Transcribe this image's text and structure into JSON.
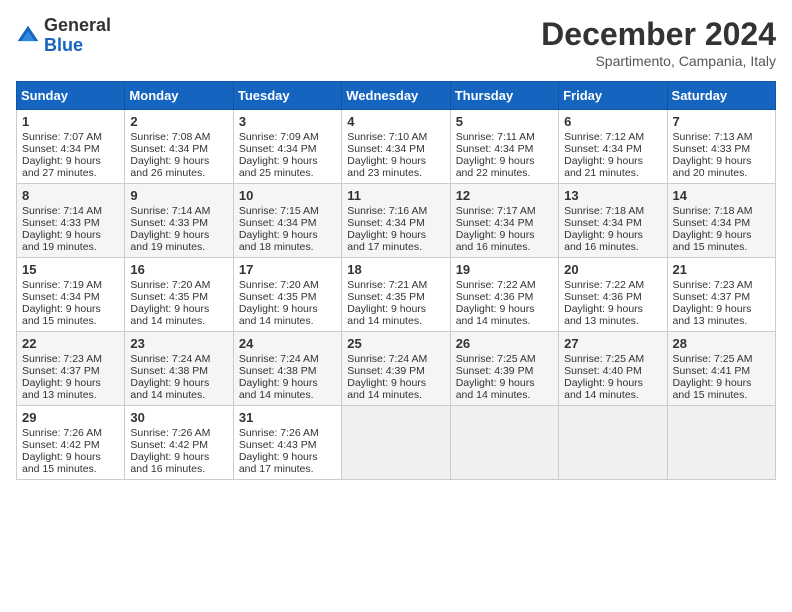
{
  "header": {
    "logo_line1": "General",
    "logo_line2": "Blue",
    "month": "December 2024",
    "location": "Spartimento, Campania, Italy"
  },
  "weekdays": [
    "Sunday",
    "Monday",
    "Tuesday",
    "Wednesday",
    "Thursday",
    "Friday",
    "Saturday"
  ],
  "weeks": [
    [
      {
        "day": "1",
        "lines": [
          "Sunrise: 7:07 AM",
          "Sunset: 4:34 PM",
          "Daylight: 9 hours",
          "and 27 minutes."
        ]
      },
      {
        "day": "2",
        "lines": [
          "Sunrise: 7:08 AM",
          "Sunset: 4:34 PM",
          "Daylight: 9 hours",
          "and 26 minutes."
        ]
      },
      {
        "day": "3",
        "lines": [
          "Sunrise: 7:09 AM",
          "Sunset: 4:34 PM",
          "Daylight: 9 hours",
          "and 25 minutes."
        ]
      },
      {
        "day": "4",
        "lines": [
          "Sunrise: 7:10 AM",
          "Sunset: 4:34 PM",
          "Daylight: 9 hours",
          "and 23 minutes."
        ]
      },
      {
        "day": "5",
        "lines": [
          "Sunrise: 7:11 AM",
          "Sunset: 4:34 PM",
          "Daylight: 9 hours",
          "and 22 minutes."
        ]
      },
      {
        "day": "6",
        "lines": [
          "Sunrise: 7:12 AM",
          "Sunset: 4:34 PM",
          "Daylight: 9 hours",
          "and 21 minutes."
        ]
      },
      {
        "day": "7",
        "lines": [
          "Sunrise: 7:13 AM",
          "Sunset: 4:33 PM",
          "Daylight: 9 hours",
          "and 20 minutes."
        ]
      }
    ],
    [
      {
        "day": "8",
        "lines": [
          "Sunrise: 7:14 AM",
          "Sunset: 4:33 PM",
          "Daylight: 9 hours",
          "and 19 minutes."
        ]
      },
      {
        "day": "9",
        "lines": [
          "Sunrise: 7:14 AM",
          "Sunset: 4:33 PM",
          "Daylight: 9 hours",
          "and 19 minutes."
        ]
      },
      {
        "day": "10",
        "lines": [
          "Sunrise: 7:15 AM",
          "Sunset: 4:34 PM",
          "Daylight: 9 hours",
          "and 18 minutes."
        ]
      },
      {
        "day": "11",
        "lines": [
          "Sunrise: 7:16 AM",
          "Sunset: 4:34 PM",
          "Daylight: 9 hours",
          "and 17 minutes."
        ]
      },
      {
        "day": "12",
        "lines": [
          "Sunrise: 7:17 AM",
          "Sunset: 4:34 PM",
          "Daylight: 9 hours",
          "and 16 minutes."
        ]
      },
      {
        "day": "13",
        "lines": [
          "Sunrise: 7:18 AM",
          "Sunset: 4:34 PM",
          "Daylight: 9 hours",
          "and 16 minutes."
        ]
      },
      {
        "day": "14",
        "lines": [
          "Sunrise: 7:18 AM",
          "Sunset: 4:34 PM",
          "Daylight: 9 hours",
          "and 15 minutes."
        ]
      }
    ],
    [
      {
        "day": "15",
        "lines": [
          "Sunrise: 7:19 AM",
          "Sunset: 4:34 PM",
          "Daylight: 9 hours",
          "and 15 minutes."
        ]
      },
      {
        "day": "16",
        "lines": [
          "Sunrise: 7:20 AM",
          "Sunset: 4:35 PM",
          "Daylight: 9 hours",
          "and 14 minutes."
        ]
      },
      {
        "day": "17",
        "lines": [
          "Sunrise: 7:20 AM",
          "Sunset: 4:35 PM",
          "Daylight: 9 hours",
          "and 14 minutes."
        ]
      },
      {
        "day": "18",
        "lines": [
          "Sunrise: 7:21 AM",
          "Sunset: 4:35 PM",
          "Daylight: 9 hours",
          "and 14 minutes."
        ]
      },
      {
        "day": "19",
        "lines": [
          "Sunrise: 7:22 AM",
          "Sunset: 4:36 PM",
          "Daylight: 9 hours",
          "and 14 minutes."
        ]
      },
      {
        "day": "20",
        "lines": [
          "Sunrise: 7:22 AM",
          "Sunset: 4:36 PM",
          "Daylight: 9 hours",
          "and 13 minutes."
        ]
      },
      {
        "day": "21",
        "lines": [
          "Sunrise: 7:23 AM",
          "Sunset: 4:37 PM",
          "Daylight: 9 hours",
          "and 13 minutes."
        ]
      }
    ],
    [
      {
        "day": "22",
        "lines": [
          "Sunrise: 7:23 AM",
          "Sunset: 4:37 PM",
          "Daylight: 9 hours",
          "and 13 minutes."
        ]
      },
      {
        "day": "23",
        "lines": [
          "Sunrise: 7:24 AM",
          "Sunset: 4:38 PM",
          "Daylight: 9 hours",
          "and 14 minutes."
        ]
      },
      {
        "day": "24",
        "lines": [
          "Sunrise: 7:24 AM",
          "Sunset: 4:38 PM",
          "Daylight: 9 hours",
          "and 14 minutes."
        ]
      },
      {
        "day": "25",
        "lines": [
          "Sunrise: 7:24 AM",
          "Sunset: 4:39 PM",
          "Daylight: 9 hours",
          "and 14 minutes."
        ]
      },
      {
        "day": "26",
        "lines": [
          "Sunrise: 7:25 AM",
          "Sunset: 4:39 PM",
          "Daylight: 9 hours",
          "and 14 minutes."
        ]
      },
      {
        "day": "27",
        "lines": [
          "Sunrise: 7:25 AM",
          "Sunset: 4:40 PM",
          "Daylight: 9 hours",
          "and 14 minutes."
        ]
      },
      {
        "day": "28",
        "lines": [
          "Sunrise: 7:25 AM",
          "Sunset: 4:41 PM",
          "Daylight: 9 hours",
          "and 15 minutes."
        ]
      }
    ],
    [
      {
        "day": "29",
        "lines": [
          "Sunrise: 7:26 AM",
          "Sunset: 4:42 PM",
          "Daylight: 9 hours",
          "and 15 minutes."
        ]
      },
      {
        "day": "30",
        "lines": [
          "Sunrise: 7:26 AM",
          "Sunset: 4:42 PM",
          "Daylight: 9 hours",
          "and 16 minutes."
        ]
      },
      {
        "day": "31",
        "lines": [
          "Sunrise: 7:26 AM",
          "Sunset: 4:43 PM",
          "Daylight: 9 hours",
          "and 17 minutes."
        ]
      },
      null,
      null,
      null,
      null
    ]
  ]
}
